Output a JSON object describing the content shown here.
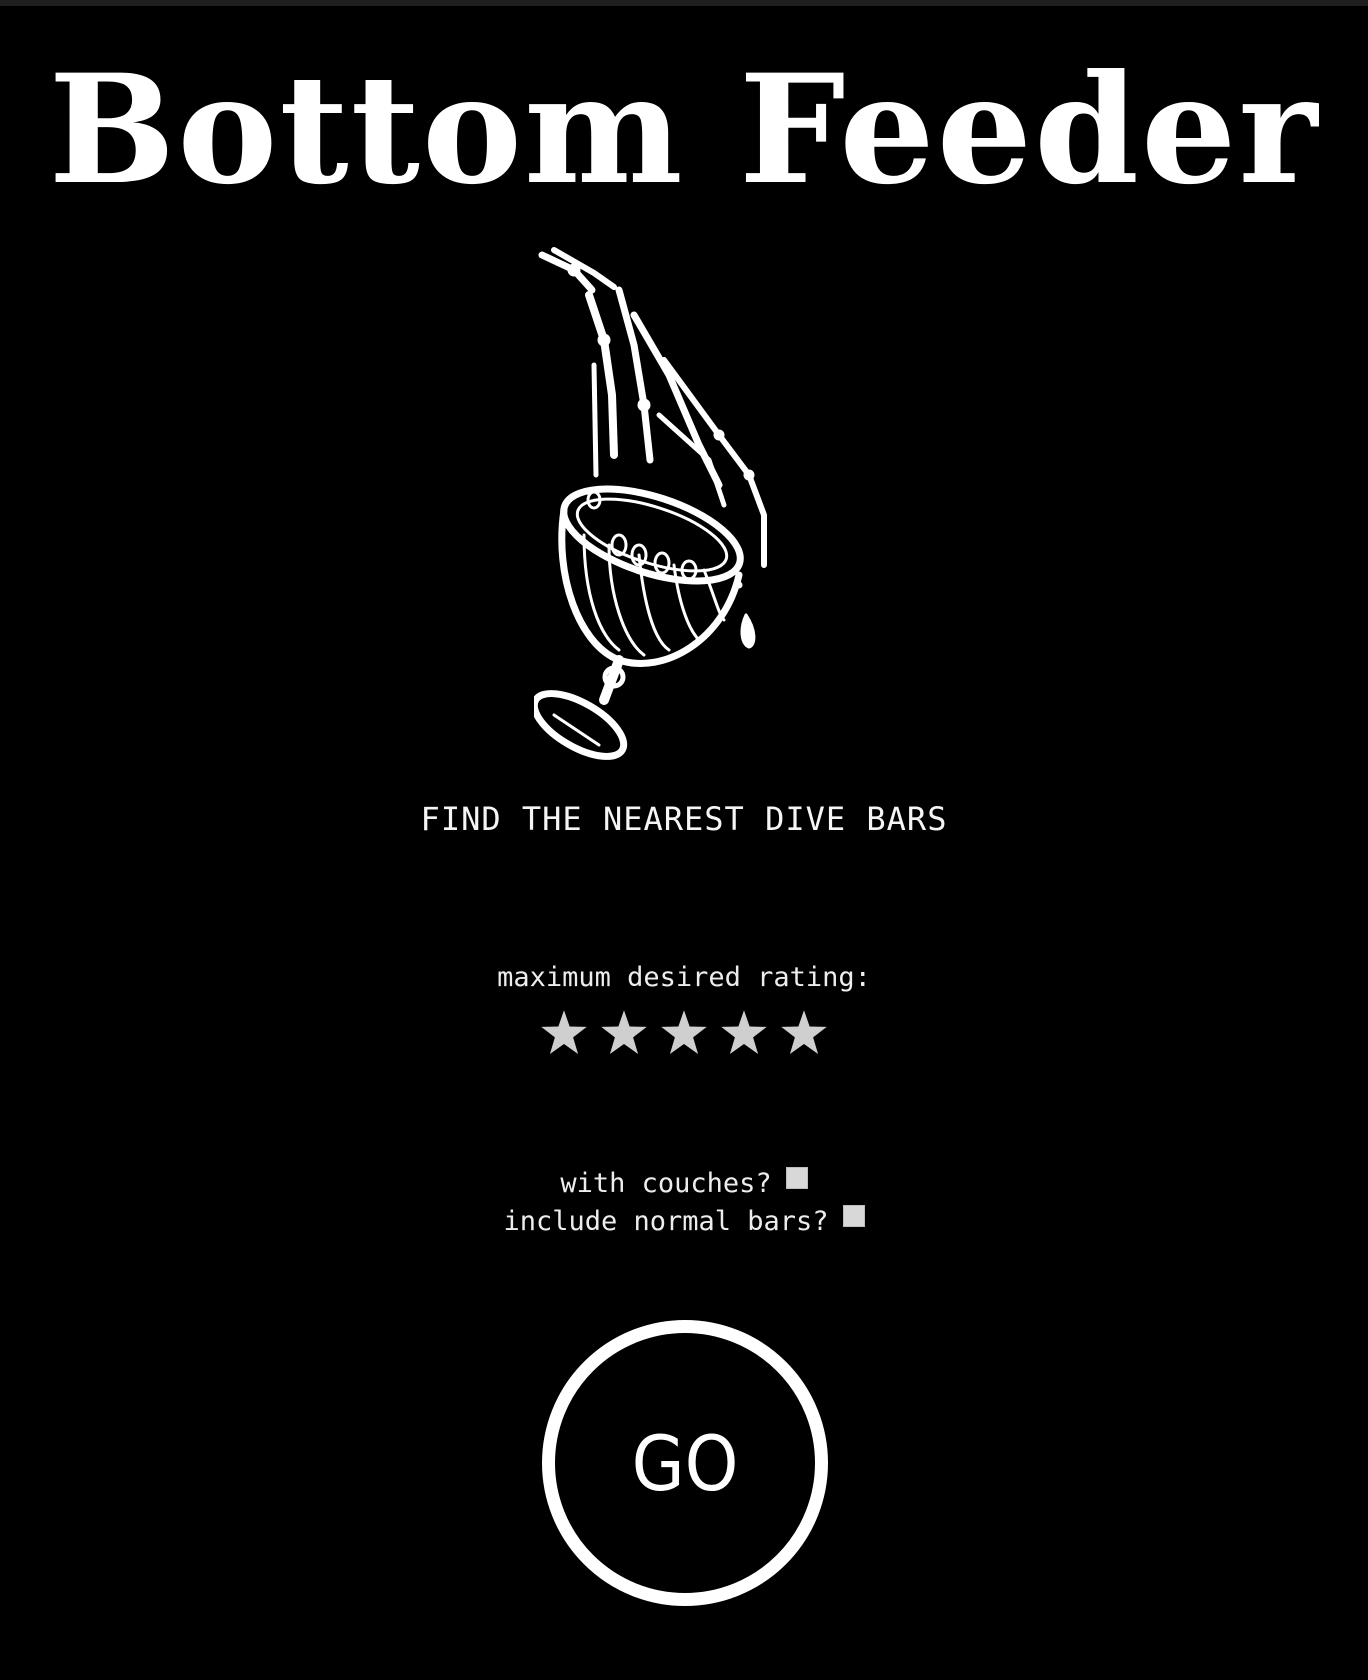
{
  "app": {
    "title": "Bottom Feeder",
    "illustration_icon": "skeleton-hand-chalice-icon",
    "tagline": "FIND THE NEAREST DIVE BARS"
  },
  "rating": {
    "label": "maximum desired rating:",
    "max_stars": 5,
    "selected": 5,
    "star_color": "#cfcfcf"
  },
  "options": [
    {
      "label": "with couches?",
      "checked": false
    },
    {
      "label": "include normal bars?",
      "checked": false
    }
  ],
  "go_button": {
    "label": "GO"
  },
  "colors": {
    "background": "#000000",
    "foreground": "#ffffff",
    "checkbox": "#d8d8d8"
  }
}
